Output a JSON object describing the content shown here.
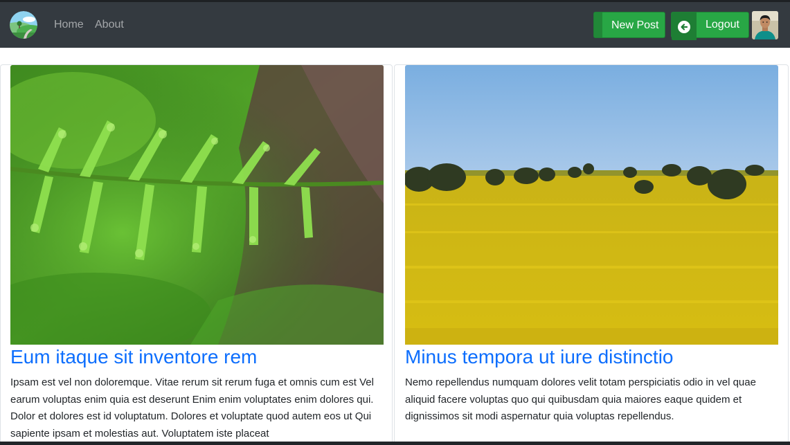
{
  "navbar": {
    "logo_icon": "landscape-logo-icon",
    "links": [
      {
        "label": "Home"
      },
      {
        "label": "About"
      }
    ],
    "new_post_label": "New Post",
    "logout_label": "Logout",
    "logout_icon": "arrow-left-circle-icon",
    "avatar_icon": "user-avatar"
  },
  "posts": [
    {
      "title": "Eum itaque sit inventore rem",
      "body": "Ipsam est vel non doloremque. Vitae rerum sit rerum fuga et omnis cum est Vel earum voluptas enim quia est deserunt Enim enim voluptates enim dolores qui. Dolor et dolores est id voluptatum. Dolores et voluptate quod autem eos ut Qui sapiente ipsam et molestias aut. Voluptatem iste placeat",
      "image": "fern-closeup-photo"
    },
    {
      "title": "Minus tempora ut iure distinctio",
      "body": "Nemo repellendus numquam dolores velit totam perspiciatis odio in vel quae aliquid facere voluptas quo qui quibusdam quia maiores eaque quidem et dignissimos sit modi aspernatur quia voluptas repellendus.",
      "image": "canola-field-photo"
    }
  ],
  "colors": {
    "navbar_bg": "#343a40",
    "button_green": "#28a745",
    "title_blue": "#0d6efd"
  }
}
